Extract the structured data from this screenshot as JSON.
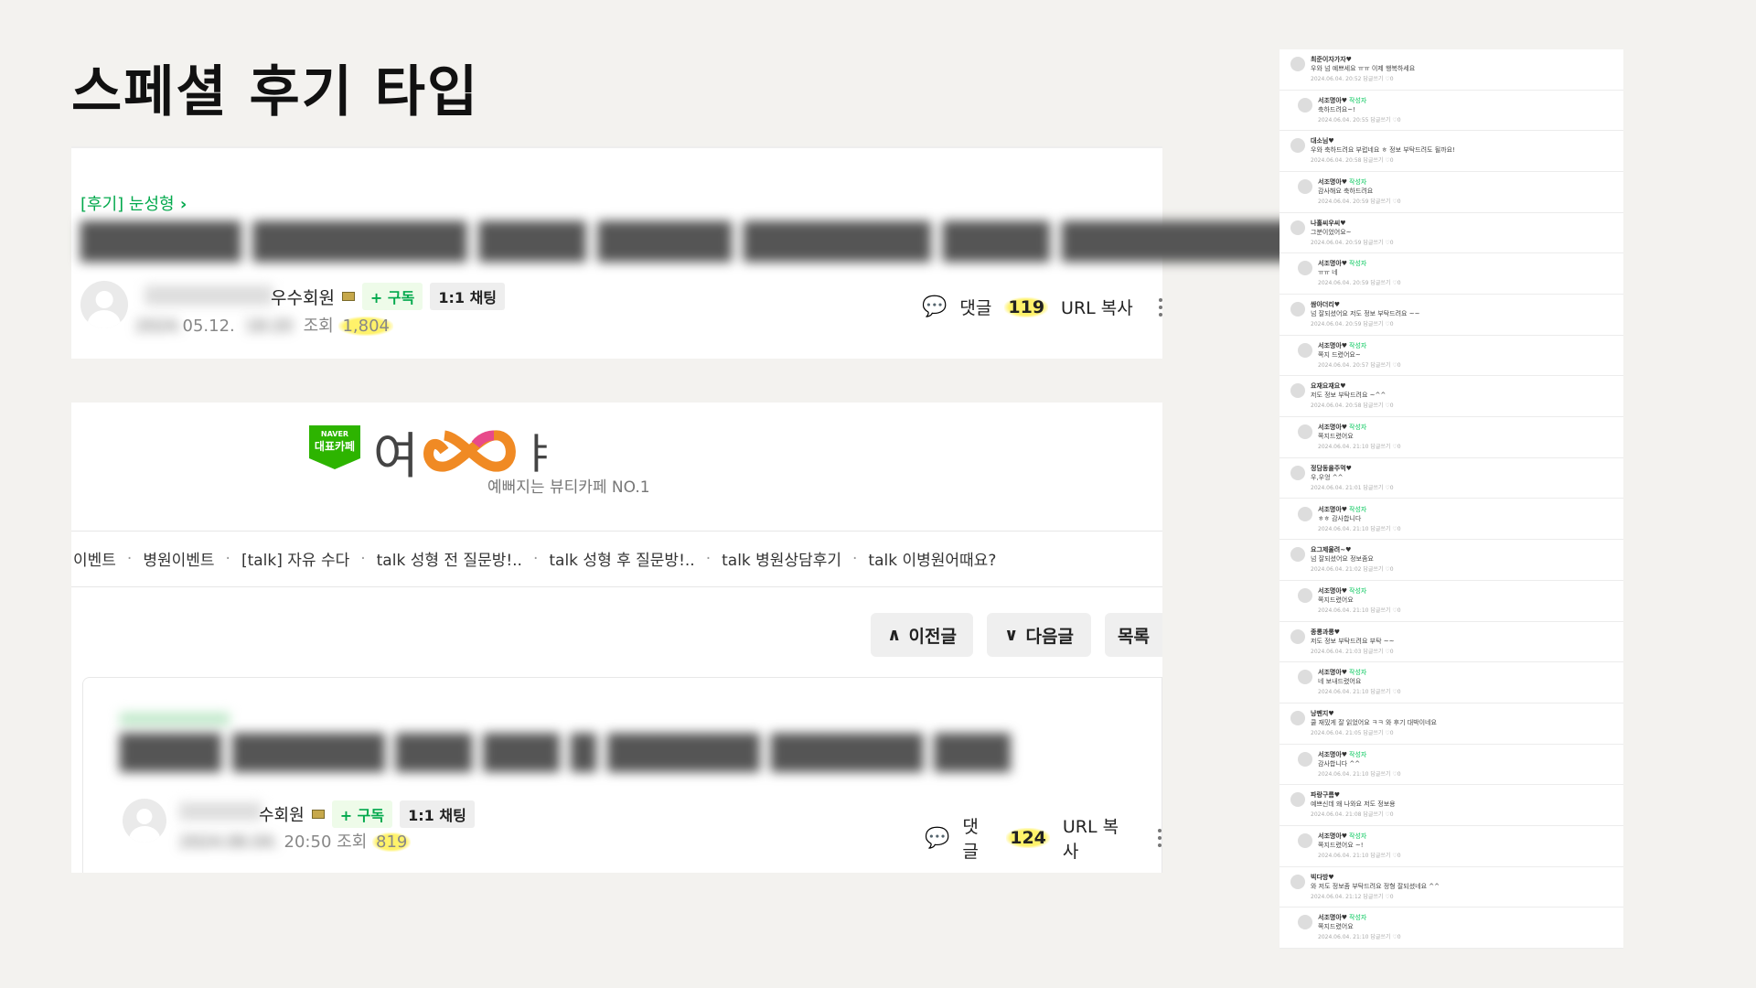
{
  "slide_title": "스페셜 후기 타입",
  "post1": {
    "category": "[후기] 눈성형",
    "grade": "우수회원",
    "subscribe": "+ 구독",
    "chat": "1:1 채팅",
    "date": "05.12.",
    "views_label": "조회",
    "views": "1,804",
    "comment_label": "댓글",
    "comment_count": "119",
    "url_copy": "URL 복사"
  },
  "cafe": {
    "naver_badge_top": "NAVER",
    "naver_badge_bottom": "대표카페",
    "logo_left": "여",
    "logo_right": "ㅑ",
    "tagline": "예뻐지는 뷰티카페 NO.1",
    "nav": [
      "이벤트",
      "병원이벤트",
      "[talk] 자유 수다",
      "talk 성형 전 질문방!..",
      "talk 성형 후 질문방!..",
      "talk 병원상담후기",
      "talk 이병원어때요?"
    ],
    "buttons": {
      "prev": "이전글",
      "next": "다음글",
      "list": "목록"
    }
  },
  "post2": {
    "grade": "수회원",
    "subscribe": "+ 구독",
    "chat": "1:1 채팅",
    "time": "20:50",
    "views_label": "조회",
    "views": "819",
    "comment_label": "댓글",
    "comment_count": "124",
    "url_copy": "URL 복사"
  },
  "comments": [
    {
      "name": "최준이자가자♥",
      "text": "우와 넘 예쁘세요 ㅠㅠ 이제 행복하세요",
      "date": "2024.06.04. 20:52  답글쓰기  ♡0",
      "reply": false
    },
    {
      "name": "서조명아♥",
      "tag": "작성자",
      "text": "축하드려요~!",
      "date": "2024.06.04. 20:55  답글쓰기  ♡0",
      "reply": true
    },
    {
      "name": "대소님♥",
      "text": "우와 축하드려요 부럽네요 ㅎ 정보 부탁드려도 될까요!",
      "date": "2024.06.04. 20:58  답글쓰기  ♡0",
      "reply": false
    },
    {
      "name": "서조명아♥",
      "tag": "작성자",
      "text": "감사해요 축하드려요",
      "date": "2024.06.04. 20:59  답글쓰기  ♡0",
      "reply": true
    },
    {
      "name": "나홀씨우씨♥",
      "text": "그분이었어요~",
      "date": "2024.06.04. 20:59  답글쓰기  ♡0",
      "reply": false
    },
    {
      "name": "서조명아♥",
      "tag": "작성자",
      "text": "ㅠㅠ 네",
      "date": "2024.06.04. 20:59  답글쓰기  ♡0",
      "reply": true
    },
    {
      "name": "쌈아더리♥",
      "text": "넘 잘되셨어요 저도 정보 부탁드려요 ~~",
      "date": "2024.06.04. 20:59  답글쓰기  ♡0",
      "reply": false
    },
    {
      "name": "서조명아♥",
      "tag": "작성자",
      "text": "쪽지 드렸어요~",
      "date": "2024.06.04. 20:57  답글쓰기  ♡0",
      "reply": true
    },
    {
      "name": "요재요재요♥",
      "text": "저도 정보 부탁드려요 ~^^",
      "date": "2024.06.04. 20:58  답글쓰기  ♡0",
      "reply": false
    },
    {
      "name": "서조명아♥",
      "tag": "작성자",
      "text": "쪽지드렸어요",
      "date": "2024.06.04. 21:10  답글쓰기  ♡0",
      "reply": true
    },
    {
      "name": "정담동을주먹♥",
      "text": "우,우엉 ^^",
      "date": "2024.06.04. 21:01  답글쓰기  ♡0",
      "reply": false
    },
    {
      "name": "서조명아♥",
      "tag": "작성자",
      "text": "ㅎㅎ 감사합니다",
      "date": "2024.06.04. 21:10  답글쓰기  ♡0",
      "reply": true
    },
    {
      "name": "요그제울려~♥",
      "text": "넘 잘되셨어요 정보좀요",
      "date": "2024.06.04. 21:02  답글쓰기  ♡0",
      "reply": false
    },
    {
      "name": "서조명아♥",
      "tag": "작성자",
      "text": "쪽지드렸어요",
      "date": "2024.06.04. 21:10  답글쓰기  ♡0",
      "reply": true
    },
    {
      "name": "종롱과롱♥",
      "text": "저도 정보 부탁드려요 부탁 ~~",
      "date": "2024.06.04. 21:03  답글쓰기  ♡0",
      "reply": false
    },
    {
      "name": "서조명아♥",
      "tag": "작성자",
      "text": "네 보내드렸어요",
      "date": "2024.06.04. 21:10  답글쓰기  ♡0",
      "reply": true
    },
    {
      "name": "낭펜지♥",
      "text": "쿨 재밌게 잘 읽었어요 ㅋㅋ 와 후기 대박이네요",
      "date": "2024.06.04. 21:05  답글쓰기  ♡0",
      "reply": false
    },
    {
      "name": "서조명아♥",
      "tag": "작성자",
      "text": "감사합니다 ^^",
      "date": "2024.06.04. 21:10  답글쓰기  ♡0",
      "reply": true
    },
    {
      "name": "파랑구름♥",
      "text": "예쁘신데 왜 나와요 저도 정보용",
      "date": "2024.06.04. 21:08  답글쓰기  ♡0",
      "reply": false
    },
    {
      "name": "서조명아♥",
      "tag": "작성자",
      "text": "쪽지드렸어요 ~!",
      "date": "2024.06.04. 21:10  답글쓰기  ♡0",
      "reply": true
    },
    {
      "name": "빅다방♥",
      "text": "와 저도 정보좀 부탁드려요 정형 잘되셨네요 ^^",
      "date": "2024.06.04. 21:12  답글쓰기  ♡0",
      "reply": false
    },
    {
      "name": "서조명아♥",
      "tag": "작성자",
      "text": "쪽지드렸어요",
      "date": "2024.06.04. 21:10  답글쓰기  ♡0",
      "reply": true
    }
  ],
  "colors": {
    "green": "#03a94d",
    "highlight": "#fff26a",
    "logo_orange": "#f08a24",
    "logo_pink": "#e84a8a"
  }
}
